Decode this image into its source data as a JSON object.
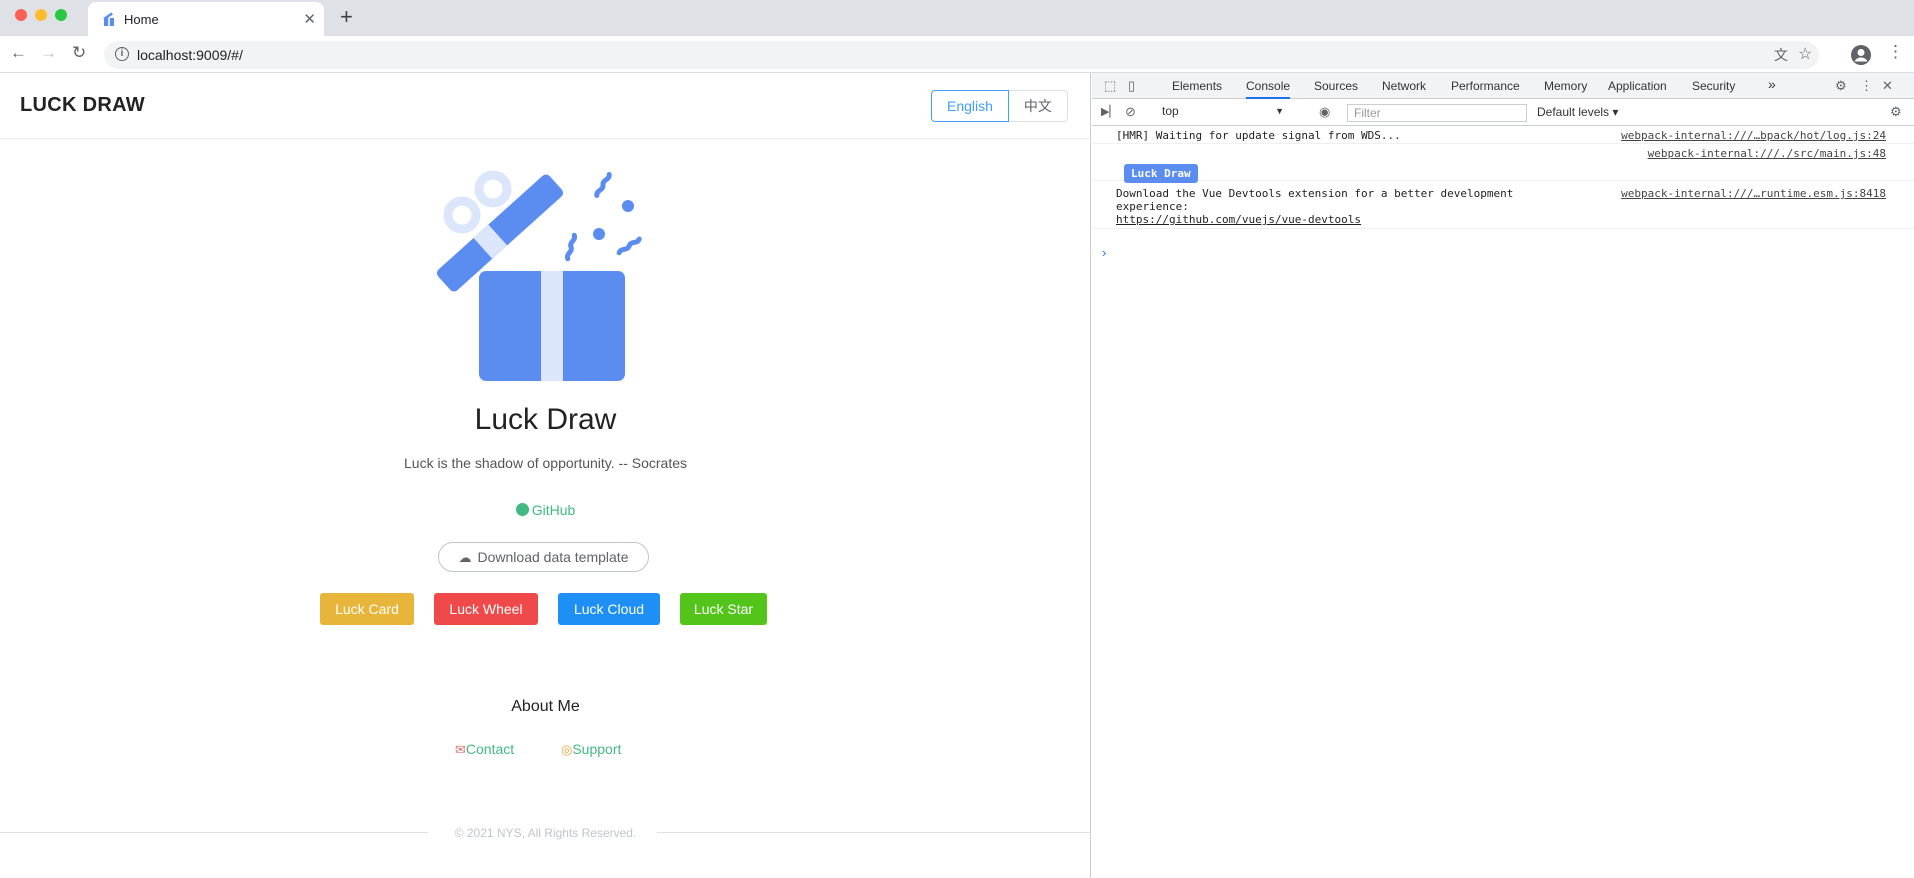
{
  "browser": {
    "tab_title": "Home",
    "tab_close": "✕",
    "new_tab": "+",
    "url": "localhost:9009/#/"
  },
  "header": {
    "logo": "LUCK DRAW",
    "lang_english": "English",
    "lang_chinese": "中文"
  },
  "main": {
    "title": "Luck Draw",
    "quote": "Luck is the shadow of opportunity. -- Socrates",
    "github": "GitHub",
    "download": "Download data template",
    "buttons": {
      "card": "Luck Card",
      "wheel": "Luck Wheel",
      "cloud": "Luck Cloud",
      "star": "Luck Star"
    },
    "about": "About Me",
    "contact": "Contact",
    "support": "Support",
    "footer": "© 2021 NYS, All Rights Reserved."
  },
  "colors": {
    "card": "#e8b53b",
    "wheel": "#f0494a",
    "cloud": "#1d8ff5",
    "star": "#52c41a",
    "gift": "#5b8cf0",
    "gift_light": "#dbe6fb"
  },
  "devtools": {
    "tabs": {
      "elements": "Elements",
      "console": "Console",
      "sources": "Sources",
      "network": "Network",
      "performance": "Performance",
      "memory": "Memory",
      "application": "Application",
      "security": "Security",
      "more": "»"
    },
    "context": "top",
    "filter_placeholder": "Filter",
    "levels": "Default levels ▾",
    "logs": {
      "hmr_msg": "[HMR] Waiting for update signal from WDS...",
      "hmr_src": "webpack-internal:///…bpack/hot/log.js:24",
      "badge_src": "webpack-internal:///./src/main.js:48",
      "badge": "Luck Draw",
      "vue_msg_1": "Download the Vue Devtools extension for a better development",
      "vue_msg_2": "experience:",
      "vue_link": "https://github.com/vuejs/vue-devtools",
      "vue_src": "webpack-internal:///…runtime.esm.js:8418"
    },
    "prompt": "›"
  }
}
